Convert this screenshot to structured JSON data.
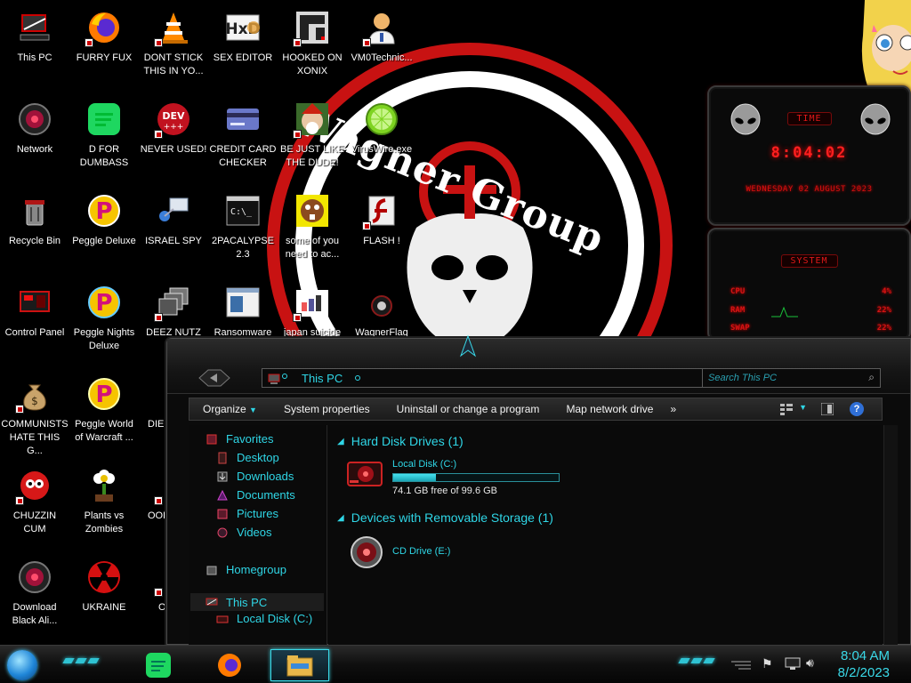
{
  "desktop": {
    "icons": [
      {
        "id": "this-pc",
        "label": "This PC"
      },
      {
        "id": "furry-fux",
        "label": "FURRY FUX"
      },
      {
        "id": "dont-stick",
        "label": "DONT STICK THIS IN YO..."
      },
      {
        "id": "sex-editor",
        "label": "SEX EDITOR"
      },
      {
        "id": "hooked-on-xonix",
        "label": "HOOKED ON XONIX"
      },
      {
        "id": "vm0technic",
        "label": "VM0Technic..."
      },
      {
        "id": "network",
        "label": "Network"
      },
      {
        "id": "d-for-dumbass",
        "label": "D FOR DUMBASS"
      },
      {
        "id": "never-used",
        "label": "NEVER USED!"
      },
      {
        "id": "credit-card-checker",
        "label": "CREDIT CARD CHECKER"
      },
      {
        "id": "be-just-like",
        "label": "BE JUST LIKE THE DUDE!"
      },
      {
        "id": "viruswire",
        "label": "VirusWire.exe"
      },
      {
        "id": "recycle-bin",
        "label": "Recycle Bin"
      },
      {
        "id": "peggle-deluxe",
        "label": "Peggle Deluxe"
      },
      {
        "id": "israel-spy",
        "label": "ISRAEL SPY"
      },
      {
        "id": "2pacalypse",
        "label": "2PACALYPSE 2.3"
      },
      {
        "id": "some-of-you",
        "label": "some of you need to ac..."
      },
      {
        "id": "flash",
        "label": "FLASH !"
      },
      {
        "id": "control-panel",
        "label": "Control Panel"
      },
      {
        "id": "peggle-nights",
        "label": "Peggle Nights Deluxe"
      },
      {
        "id": "deez-nutz",
        "label": "DEEZ NUTZ"
      },
      {
        "id": "ransomware",
        "label": "Ransomware"
      },
      {
        "id": "japan-suicide",
        "label": "japan suicide"
      },
      {
        "id": "wagnerflag",
        "label": "WagnerFlag"
      },
      {
        "id": "communists",
        "label": "COMMUNISTS HATE THIS G..."
      },
      {
        "id": "peggle-world",
        "label": "Peggle World of Warcraft ..."
      },
      {
        "id": "die-p",
        "label": "DIE P"
      },
      {
        "id": "chuzzin-cum",
        "label": "CHUZZIN CUM"
      },
      {
        "id": "plants-vs-zombies",
        "label": "Plants vs Zombies"
      },
      {
        "id": "oops-do",
        "label": "OOPS DO"
      },
      {
        "id": "download-black-ali",
        "label": "Download Black Ali..."
      },
      {
        "id": "ukraine",
        "label": "UKRAINE"
      },
      {
        "id": "oc",
        "label": "OC"
      }
    ]
  },
  "wallpaper": {
    "text": "Wagner Group"
  },
  "gadgets": {
    "clock": {
      "title": "TIME",
      "time": "8:04:02",
      "date": "WEDNESDAY 02 AUGUST 2023"
    },
    "system": {
      "title": "SYSTEM",
      "rows": [
        {
          "label": "CPU",
          "value": "4%"
        },
        {
          "label": "RAM",
          "value": "22%"
        },
        {
          "label": "SWAP",
          "value": "22%"
        }
      ]
    }
  },
  "explorer": {
    "address": "This PC",
    "search_placeholder": "Search This PC",
    "commands": {
      "organize": "Organize",
      "system_properties": "System properties",
      "uninstall": "Uninstall or change a program",
      "map_drive": "Map network drive",
      "more": "»"
    },
    "nav": {
      "favorites": "Favorites",
      "desktop": "Desktop",
      "downloads": "Downloads",
      "documents": "Documents",
      "pictures": "Pictures",
      "videos": "Videos",
      "homegroup": "Homegroup",
      "this_pc": "This PC",
      "local_disk": "Local Disk (C:)"
    },
    "groups": {
      "hdd": "Hard Disk Drives (1)",
      "removable": "Devices with Removable Storage (1)"
    },
    "drives": {
      "c_name": "Local Disk (C:)",
      "c_free": "74.1 GB free of 99.6 GB",
      "c_used_fraction": 0.256,
      "e_name": "CD Drive (E:)"
    }
  },
  "taskbar": {
    "time": "8:04 AM",
    "date": "8/2/2023"
  },
  "colors": {
    "accent": "#2fd6e6",
    "red": "#d31414"
  }
}
